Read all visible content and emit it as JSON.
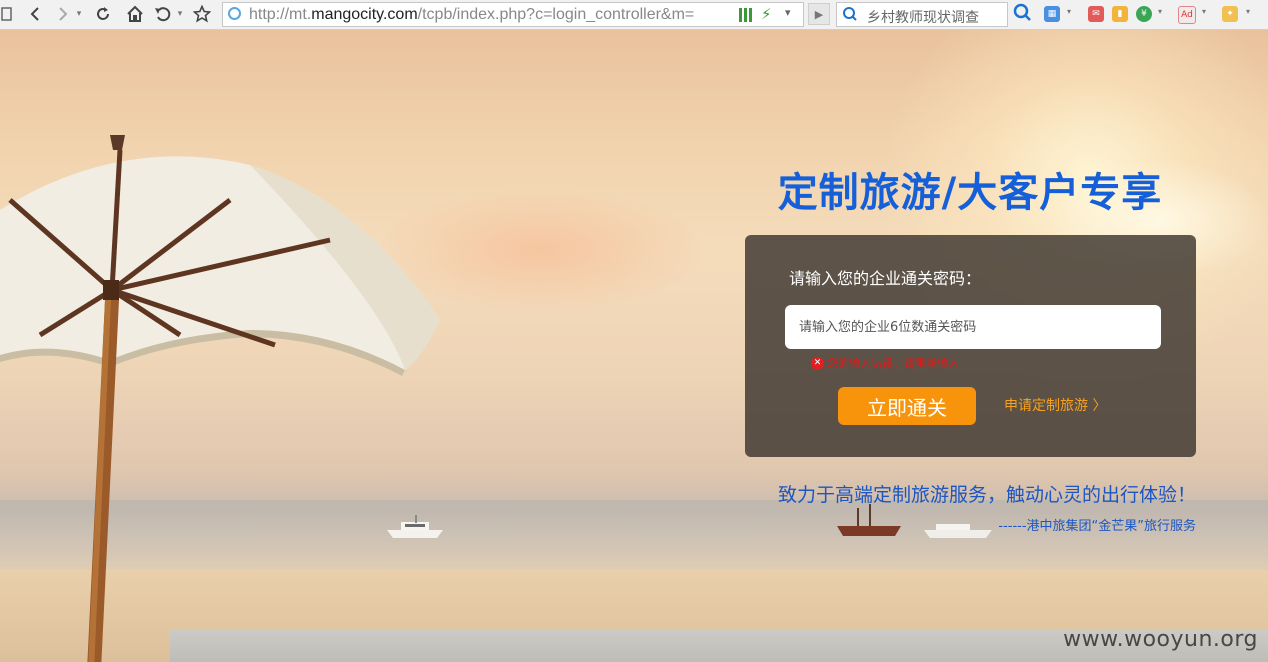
{
  "browser": {
    "url_prefix": "http://mt.",
    "url_domain": "mangocity.com",
    "url_rest": "/tcpb/index.php?c=login_controller&m=",
    "search_text": "乡村教师现状调查",
    "icons": [
      "back-icon",
      "forward-icon",
      "reload-icon",
      "home-icon",
      "undo-icon",
      "star-icon",
      "search-icon"
    ]
  },
  "page": {
    "headline": "定制旅游/大客户专享",
    "prompt": "请输入您的企业通关密码：",
    "input_placeholder": "请输入您的企业6位数通关密码",
    "error_text": "您的输入错误，请重新输入",
    "submit_label": "立即通关",
    "apply_link": "申请定制旅游 〉",
    "slogan": "致力于高端定制旅游服务，触动心灵的出行体验！",
    "signature": "------港中旅集团“金芒果”旅行服务",
    "watermark": "www.wooyun.org"
  },
  "colors": {
    "headline": "#1560d8",
    "submit": "#f7940c",
    "error": "#e01818",
    "link": "#f7a11e"
  }
}
